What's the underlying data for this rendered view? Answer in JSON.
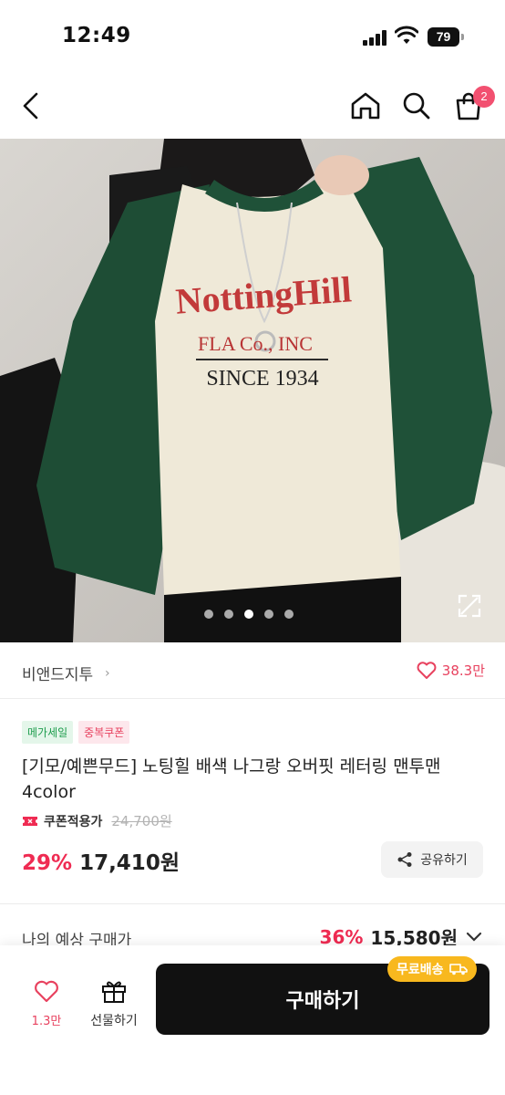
{
  "status_bar": {
    "time": "12:49",
    "battery": "79"
  },
  "nav": {
    "cart_badge": "2"
  },
  "hero": {
    "print_line1": "NottingHill",
    "print_line2": "FLA Co., INC",
    "print_line3": "SINCE 1934",
    "slide_count": 5,
    "active_slide": 2
  },
  "seller": {
    "name": "비앤드지투",
    "chevron": "›",
    "likes": "38.3만"
  },
  "product": {
    "badges": [
      "메가세일",
      "중복쿠폰"
    ],
    "title": "[기모/예쁜무드] 노팅힐 배색 나그랑 오버핏 레터링 맨투맨 4color",
    "coupon_label": "쿠폰적용가",
    "original_price": "24,700원",
    "discount": "29%",
    "price": "17,410원",
    "share_label": "공유하기"
  },
  "expected": {
    "label": "나의 예상 구매가",
    "discount": "36%",
    "price": "15,580원"
  },
  "bottom_bar": {
    "like_count": "1.3만",
    "gift_label": "선물하기",
    "buy_label": "구매하기",
    "free_shipping": "무료배송"
  },
  "colors": {
    "accent": "#ef2b52",
    "like": "#e8425f",
    "badge_green": "#1f9d4e",
    "free_ship": "#f8b81e"
  }
}
